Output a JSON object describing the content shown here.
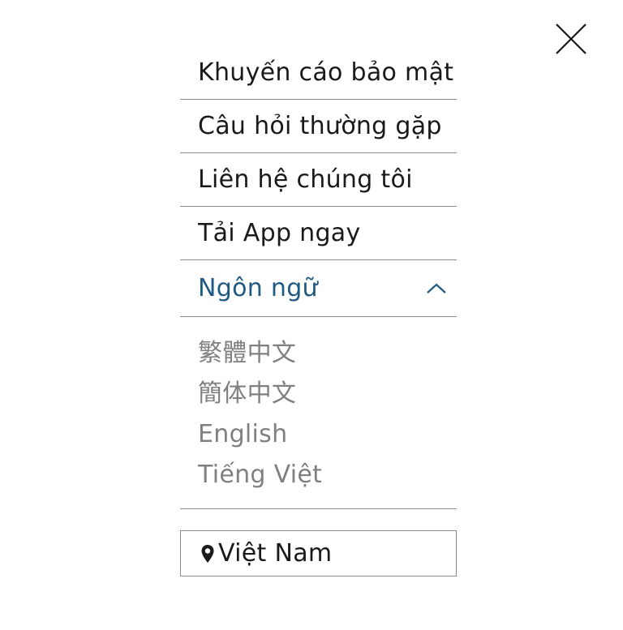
{
  "menu": {
    "items": [
      {
        "label": "Khuyến cáo bảo mật"
      },
      {
        "label": "Câu hỏi thường gặp"
      },
      {
        "label": "Liên hệ chúng tôi"
      },
      {
        "label": "Tải App ngay"
      }
    ],
    "language": {
      "label": "Ngôn ngữ",
      "expanded": true,
      "options": [
        {
          "label": "繁體中文"
        },
        {
          "label": "簡体中文"
        },
        {
          "label": "English"
        },
        {
          "label": "Tiếng Việt"
        }
      ]
    },
    "region": {
      "label": "Việt Nam",
      "icon": "location-pin-icon"
    }
  },
  "colors": {
    "accent": "#205a82",
    "text": "#1a1a1a",
    "muted": "#808080",
    "divider": "#8a8a8a"
  },
  "icons": {
    "close": "close-icon",
    "chevron": "chevron-up-icon"
  }
}
